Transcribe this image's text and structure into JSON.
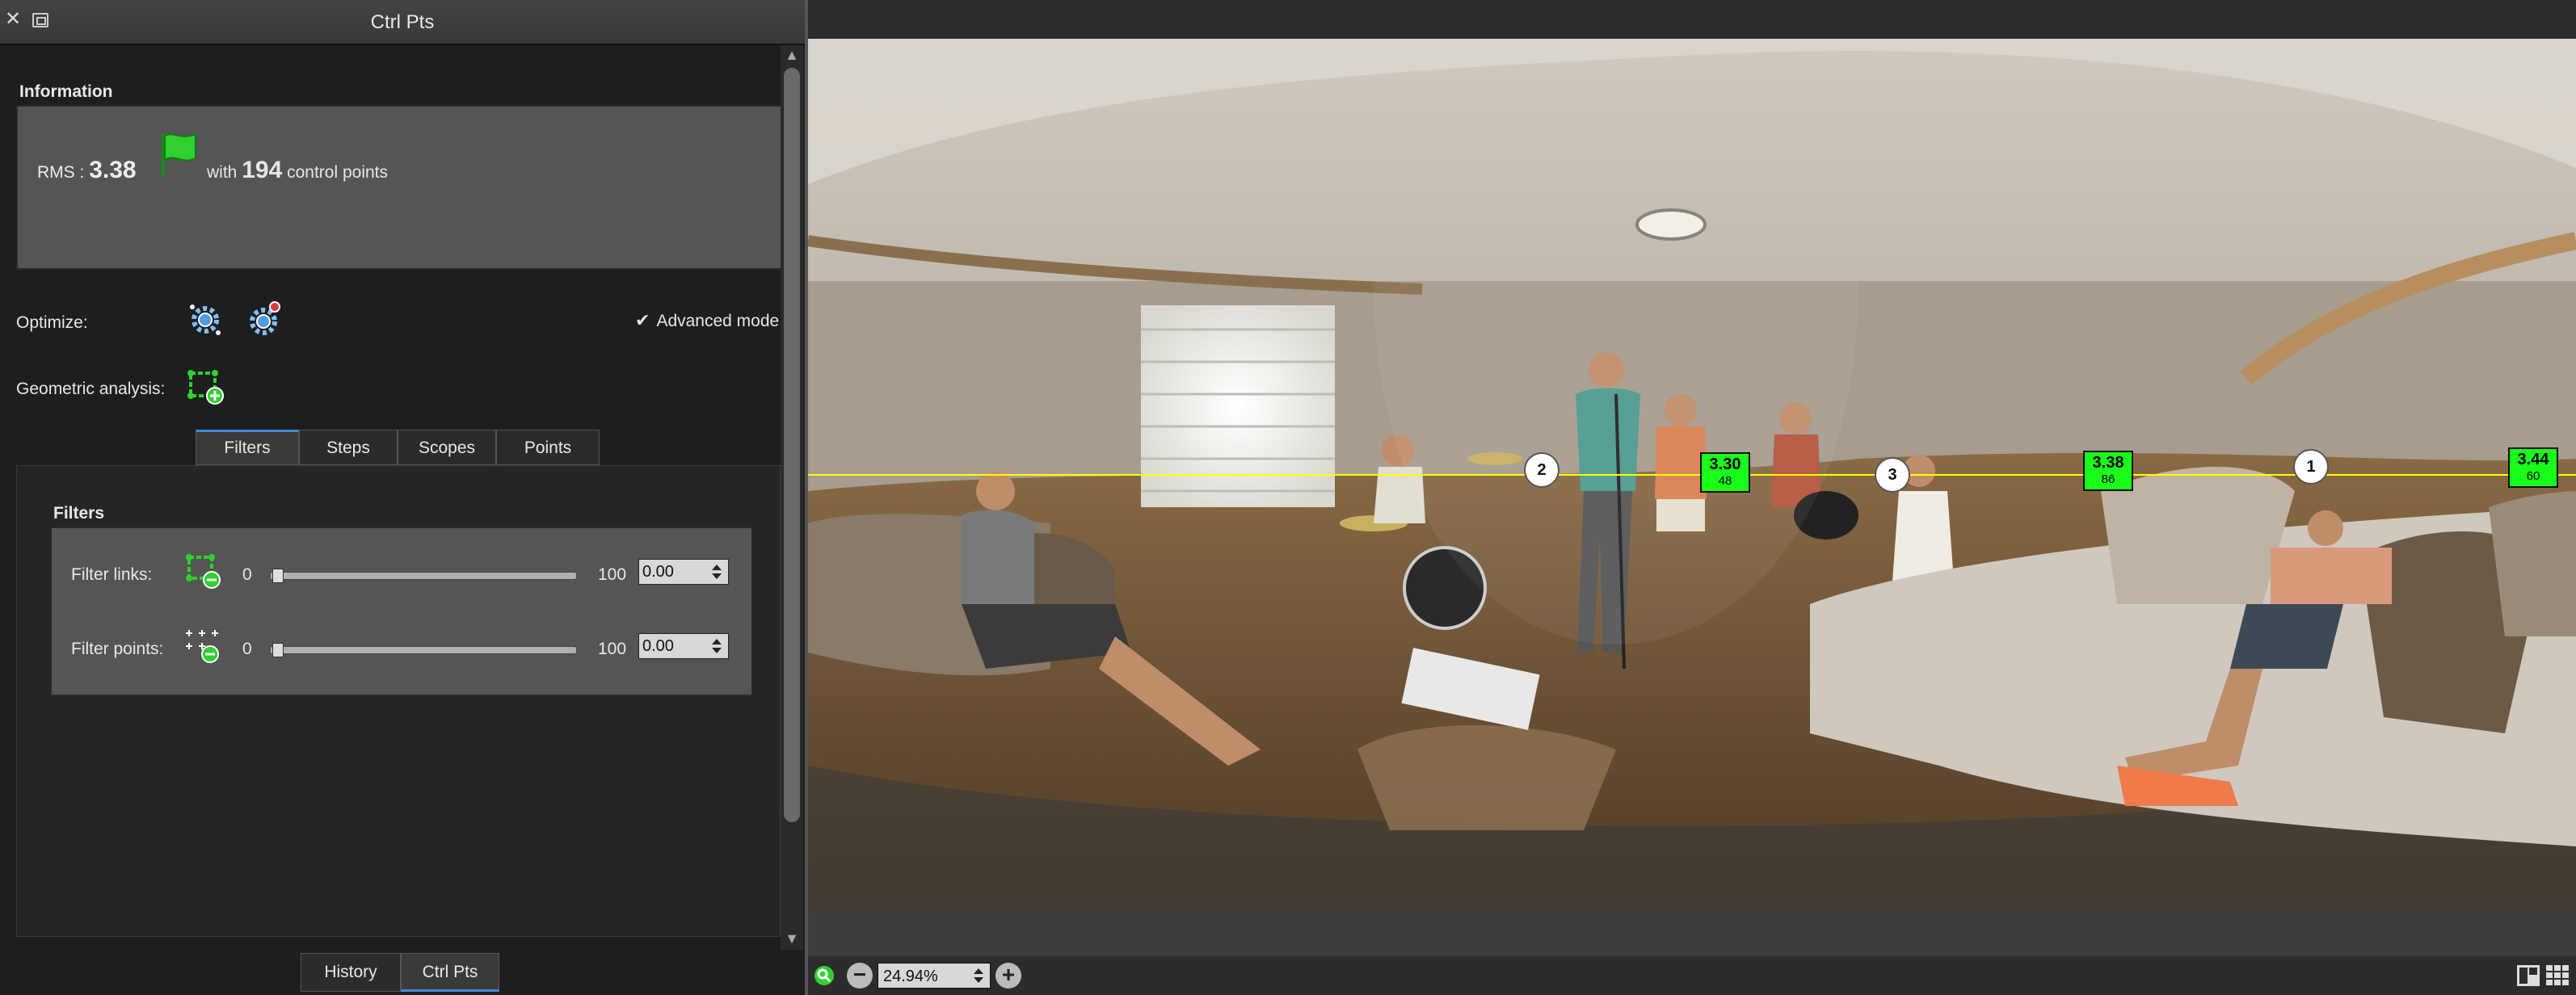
{
  "window": {
    "title": "Ctrl Pts"
  },
  "information": {
    "heading": "Information",
    "rms_label": "RMS :",
    "rms_value": "3.38",
    "with_label": "with",
    "control_point_count": "194",
    "control_points_label": "control points",
    "status_flag_color": "#2fd12f"
  },
  "optimize": {
    "label": "Optimize:"
  },
  "advanced_mode": {
    "label": "Advanced mode",
    "checked": true
  },
  "geometric_analysis": {
    "label": "Geometric analysis:"
  },
  "tabs": [
    {
      "label": "Filters",
      "active": true
    },
    {
      "label": "Steps",
      "active": false
    },
    {
      "label": "Scopes",
      "active": false
    },
    {
      "label": "Points",
      "active": false
    }
  ],
  "filters": {
    "heading": "Filters",
    "links": {
      "label": "Filter links:",
      "min": "0",
      "max": "100",
      "value": "0.00",
      "fraction": 0
    },
    "points": {
      "label": "Filter points:",
      "min": "0",
      "max": "100",
      "value": "0.00",
      "fraction": 0
    }
  },
  "bottom_tabs": [
    {
      "label": "History",
      "active": false
    },
    {
      "label": "Ctrl Pts",
      "active": true
    }
  ],
  "viewer": {
    "zoom": "24.94%",
    "horizon_color": "#ffff00",
    "cp_circles": [
      "2",
      "3",
      "1"
    ],
    "cp_boxes": [
      {
        "rms": "3.30",
        "count": "48"
      },
      {
        "rms": "3.38",
        "count": "86"
      },
      {
        "rms": "3.44",
        "count": "60"
      }
    ]
  }
}
